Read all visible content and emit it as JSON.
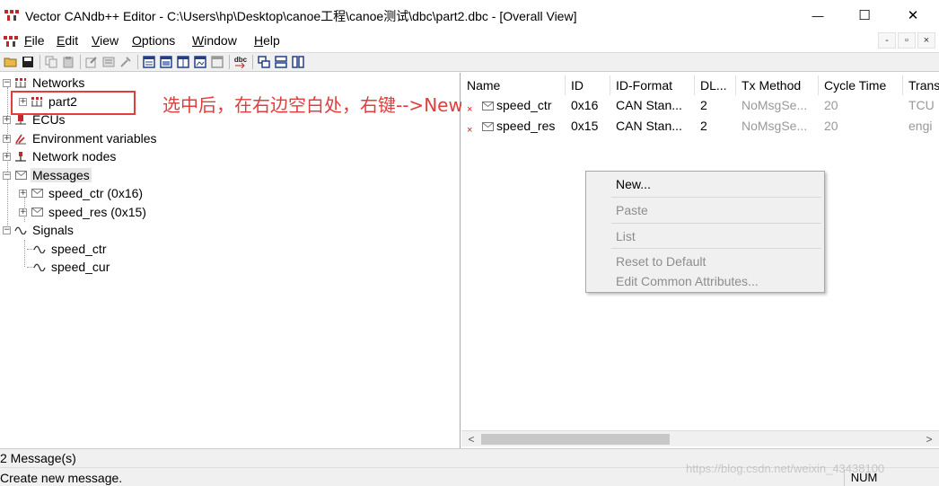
{
  "window": {
    "title": "Vector CANdb++ Editor - C:\\Users\\hp\\Desktop\\canoe工程\\canoe测试\\dbc\\part2.dbc - [Overall View]",
    "minimize_glyph": "—",
    "maximize_glyph": "☐",
    "close_glyph": "✕"
  },
  "menu": {
    "items": [
      "File",
      "Edit",
      "View",
      "Options",
      "Window",
      "Help"
    ],
    "mdi": [
      "-",
      "▫",
      "×"
    ]
  },
  "toolbar": {
    "icons": [
      "open-icon",
      "save-icon",
      "copy-icon",
      "paste-icon",
      "edit-icon",
      "list-icon",
      "tool-icon",
      "overall-view-icon",
      "view2-icon",
      "view3-icon",
      "view4-icon",
      "view5-icon",
      "dbc-export-icon",
      "cascade-icon",
      "tile-horizontal-icon",
      "tile-vertical-icon"
    ],
    "export_label": "dbc"
  },
  "tree": {
    "networks": "Networks",
    "part2": "part2",
    "ecus": "ECUs",
    "env_vars": "Environment variables",
    "network_nodes": "Network nodes",
    "messages": "Messages",
    "msg1": "speed_ctr (0x16)",
    "msg2": "speed_res (0x15)",
    "signals": "Signals",
    "sig1": "speed_ctr",
    "sig2": "speed_cur",
    "expand_glyph": "+",
    "collapse_glyph": "−"
  },
  "annotation": {
    "text": "选中后，在右边空白处，右键-->New",
    "color": "#e23c3c"
  },
  "table": {
    "columns": [
      "Name",
      "ID",
      "ID-Format",
      "DL...",
      "Tx Method",
      "Cycle Time",
      "Trans"
    ],
    "row_mark": "×",
    "rows": [
      [
        "speed_ctr",
        "0x16",
        "CAN Stan...",
        "2",
        "NoMsgSe...",
        "20",
        "TCU"
      ],
      [
        "speed_res",
        "0x15",
        "CAN Stan...",
        "2",
        "NoMsgSe...",
        "20",
        "engi"
      ]
    ],
    "scroll_left": "<",
    "scroll_right": ">"
  },
  "context_menu": {
    "new": "New...",
    "paste": "Paste",
    "list": "List",
    "reset": "Reset to Default",
    "edit_common": "Edit Common Attributes..."
  },
  "status": {
    "count": "2 Message(s)",
    "hint": "Create new message.",
    "num": "NUM",
    "watermark": "https://blog.csdn.net/weixin_43438100"
  },
  "colors": {
    "accent_red": "#e23c3c",
    "toolbar_bg": "#f0f0f0"
  }
}
